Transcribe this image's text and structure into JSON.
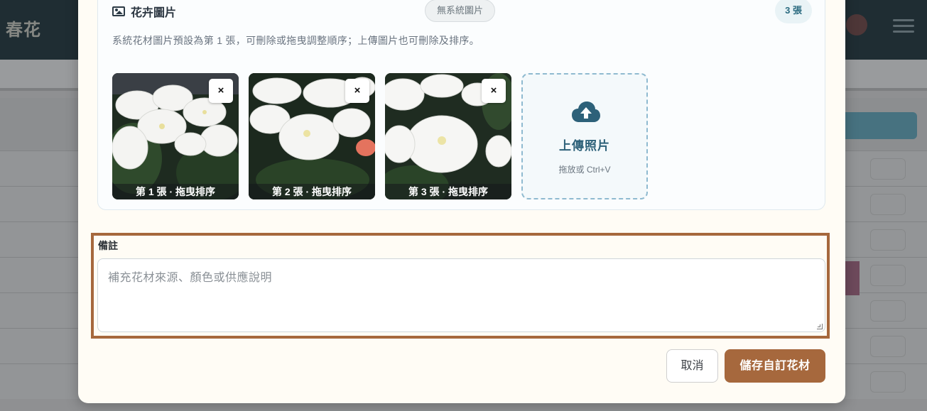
{
  "background": {
    "logo_text": "春花"
  },
  "images_section": {
    "title": "花卉圖片",
    "title_icon": "image-icon",
    "no_system_badge": "無系統圖片",
    "count_badge": "3 張",
    "description": "系統花材圖片預設為第 1 張，可刪除或拖曳調整順序；上傳圖片也可刪除及排序。",
    "thumbnails": [
      {
        "caption": "第 1 張 · 拖曳排序",
        "remove_label": "×"
      },
      {
        "caption": "第 2 張 · 拖曳排序",
        "remove_label": "×"
      },
      {
        "caption": "第 3 張 · 拖曳排序",
        "remove_label": "×"
      }
    ],
    "upload": {
      "icon": "cloud-upload-icon",
      "label": "上傳照片",
      "hint": "拖放或 Ctrl+V"
    }
  },
  "notes": {
    "label": "備註",
    "value": "",
    "placeholder": "補充花材來源、顏色或供應說明"
  },
  "actions": {
    "cancel_label": "取消",
    "save_label": "儲存自訂花材"
  },
  "colors": {
    "accent": "#a6683d",
    "upload_accent": "#2d6179"
  }
}
